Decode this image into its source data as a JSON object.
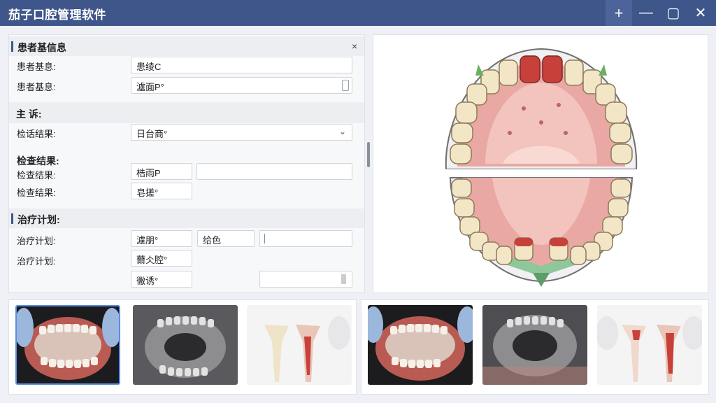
{
  "window": {
    "title": "茄子口腔管理软件",
    "buttons": {
      "add": "+",
      "minimize": "—",
      "maximize": "▢",
      "close": "✕"
    }
  },
  "patient_section": {
    "title": "患者基信息",
    "close": "×",
    "row1_label": "患者基息:",
    "row1_value": "患绫C",
    "row2_label": "患者基息:",
    "row2_value": "瀘面P°"
  },
  "complaint_section": {
    "title": "主  诉:",
    "row_label": "检话结果:",
    "row_value": "日台商°"
  },
  "exam_section": {
    "title": "检查结果:",
    "row1_label": "检查结果:",
    "row1_value": "梏雨P",
    "row2_label": "检查结果:",
    "row2_value": "皂搓°"
  },
  "treatment_section": {
    "title": "治疗计划:",
    "row1_label": "治疗计划:",
    "row1_value": "濾朋°",
    "row1_value2": "给色",
    "row2_label": "治疗计划:",
    "row2_value": "薾仌腔°",
    "row3_value": "徶诱°"
  },
  "thumbnails": [
    {
      "name": "intraoral-photo-1",
      "selected": true
    },
    {
      "name": "xray-1",
      "selected": false
    },
    {
      "name": "tooth-model-1",
      "selected": false
    },
    {
      "name": "intraoral-photo-2",
      "selected": false
    },
    {
      "name": "xray-2",
      "selected": false
    },
    {
      "name": "tooth-model-2",
      "selected": false
    }
  ],
  "colors": {
    "titlebar": "#3e5689",
    "accent": "#3e5689",
    "selection": "#5b8ee0",
    "gum": "#e9a8a3",
    "tooth": "#f3e6c7",
    "highlight_tooth": "#c7403a"
  }
}
